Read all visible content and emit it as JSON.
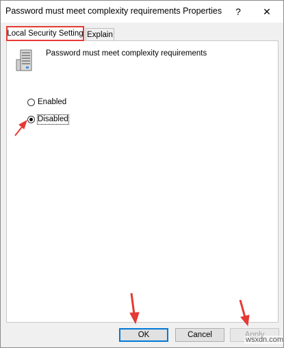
{
  "window": {
    "title": "Password must meet complexity requirements Properties",
    "help_label": "?",
    "close_label": "✕"
  },
  "tabs": [
    {
      "label": "Local Security Setting",
      "active": true
    },
    {
      "label": "Explain",
      "active": false
    }
  ],
  "policy": {
    "name": "Password must meet complexity requirements",
    "icon": "server-policy-icon"
  },
  "options": [
    {
      "label": "Enabled",
      "selected": false
    },
    {
      "label": "Disabled",
      "selected": true
    }
  ],
  "buttons": {
    "ok": "OK",
    "cancel": "Cancel",
    "apply": "Apply"
  },
  "annotations": {
    "highlight_color": "#e53935",
    "arrow_color": "#e53935"
  },
  "watermark": "wsxdn.com"
}
